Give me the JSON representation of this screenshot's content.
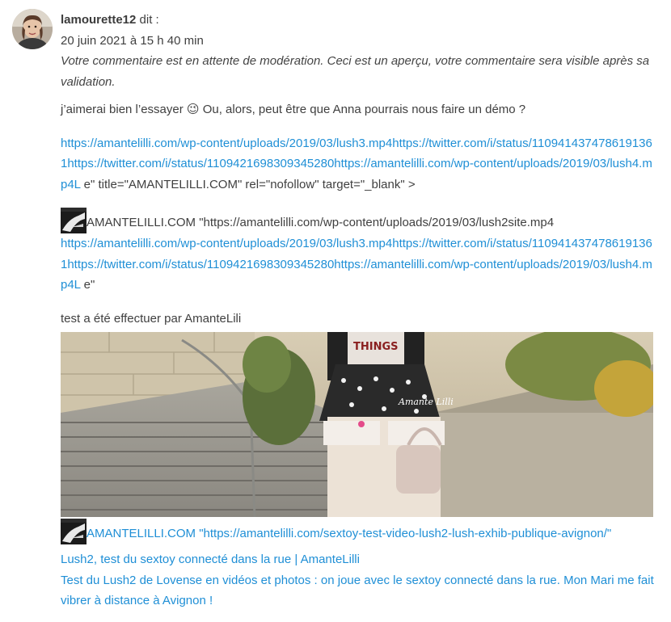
{
  "comment": {
    "author": "lamourette12",
    "says": " dit :",
    "date": "20 juin 2021 à 15 h 40 min",
    "moderation_note": "Votre commentaire est en attente de modération. Ceci est un aperçu, votre commentaire sera visible après sa validation.",
    "text_before_emoji": "j’aimerai bien l’essayer ",
    "emoji": "😉",
    "text_after_emoji": " Ou, alors, peut être que Anna pourrais nous faire un démo ?",
    "block1_link": "https://amantelilli.com/wp-content/uploads/2019/03/lush3.mp4https://twitter.com/i/status/1109414374786191361https://twitter.com/i/status/1109421698309345280https://amantelilli.com/wp-content/uploads/2019/03/lush4.mp4L",
    "block1_tail": " e\" title=\"AMANTELILLI.COM\" rel=\"nofollow\" target=\"_blank\" >",
    "embed1_label": "AMANTELILLI.COM \"https://amantelilli.com/wp-content/uploads/2019/03/lush2site.mp4",
    "block2_link": "https://amantelilli.com/wp-content/uploads/2019/03/lush3.mp4https://twitter.com/i/status/1109414374786191361https://twitter.com/i/status/1109421698309345280https://amantelilli.com/wp-content/uploads/2019/03/lush4.mp4L",
    "block2_tail": " e\"",
    "test_line": "test a été effectuer par AmanteLili",
    "photo_watermark": "Amante Lilli",
    "photo_shirt_text": "THINGS",
    "embed2_label": "AMANTELILLI.COM \"https://amantelilli.com/sextoy-test-video-lush2-lush-exhib-publique-avignon/\"",
    "card_title": "Lush2, test du sextoy connecté dans la rue | AmanteLilli",
    "card_description": "Test du Lush2 de Lovense en vidéos et photos : on joue avec le sextoy connecté dans la rue. Mon Mari me fait vibrer à distance à Avignon !"
  },
  "colors": {
    "link": "#1f8fd6",
    "text": "#3f3f3f"
  }
}
